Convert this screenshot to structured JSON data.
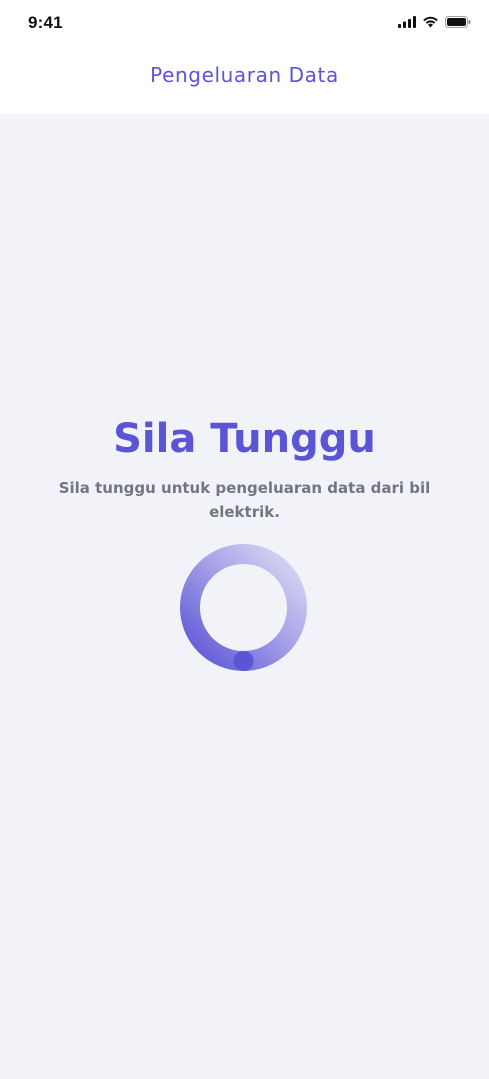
{
  "status_bar": {
    "time": "9:41",
    "icons": [
      "signal-icon",
      "wifi-icon",
      "battery-icon"
    ]
  },
  "header": {
    "title": "Pengeluaran Data"
  },
  "loading": {
    "title": "Sila Tunggu",
    "message": "Sila tunggu untuk pengeluaran data dari bil elektrik."
  },
  "colors": {
    "accent": "#5b55d6",
    "background": "#f2f3f8",
    "muted_text": "#73767e"
  }
}
